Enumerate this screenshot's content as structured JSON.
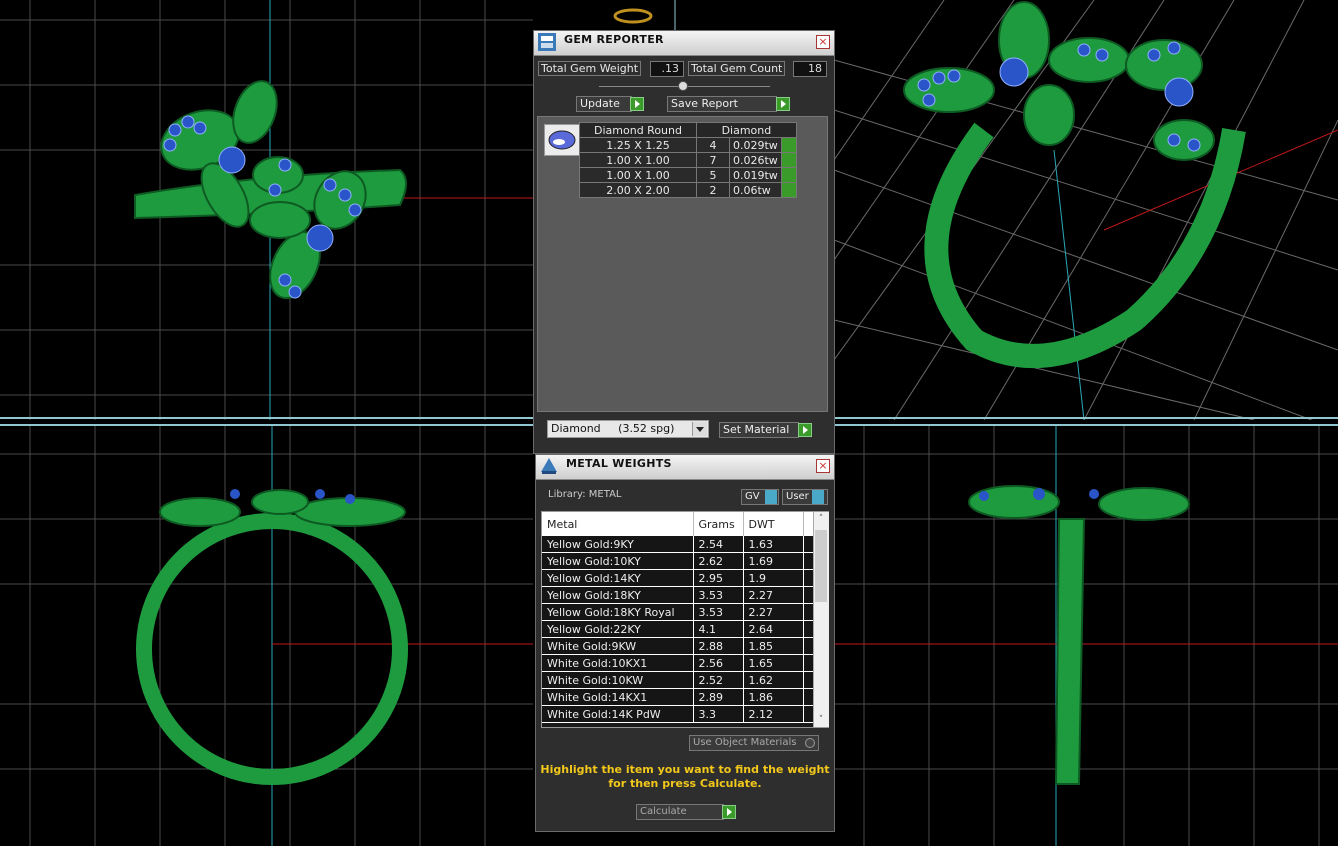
{
  "gem_reporter": {
    "title": "GEM REPORTER",
    "total_gem_weight_label": "Total Gem Weight",
    "total_gem_weight_value": ".13",
    "total_gem_count_label": "Total Gem Count",
    "total_gem_count_value": "18",
    "update_label": "Update",
    "save_report_label": "Save Report",
    "table_headers": [
      "Diamond Round",
      "Diamond"
    ],
    "rows": [
      {
        "size": "1.25 X 1.25",
        "count": "4",
        "weight": "0.029tw"
      },
      {
        "size": "1.00 X 1.00",
        "count": "7",
        "weight": "0.026tw"
      },
      {
        "size": "1.00 X 1.00",
        "count": "5",
        "weight": "0.019tw"
      },
      {
        "size": "2.00 X 2.00",
        "count": "2",
        "weight": "0.06tw"
      }
    ],
    "material_select": "Diamond     (3.52 spg)",
    "set_material_label": "Set Material"
  },
  "metal_weights": {
    "title": "METAL WEIGHTS",
    "library_label": "Library: METAL",
    "gv_label": "GV",
    "user_label": "User",
    "columns": [
      "Metal",
      "Grams",
      "DWT"
    ],
    "rows": [
      {
        "metal": "Yellow Gold:9KY",
        "grams": "2.54",
        "dwt": "1.63"
      },
      {
        "metal": "Yellow Gold:10KY",
        "grams": "2.62",
        "dwt": "1.69"
      },
      {
        "metal": "Yellow Gold:14KY",
        "grams": "2.95",
        "dwt": "1.9"
      },
      {
        "metal": "Yellow Gold:18KY",
        "grams": "3.53",
        "dwt": "2.27"
      },
      {
        "metal": "Yellow Gold:18KY Royal",
        "grams": "3.53",
        "dwt": "2.27"
      },
      {
        "metal": "Yellow Gold:22KY",
        "grams": "4.1",
        "dwt": "2.64"
      },
      {
        "metal": "White Gold:9KW",
        "grams": "2.88",
        "dwt": "1.85"
      },
      {
        "metal": "White Gold:10KX1",
        "grams": "2.56",
        "dwt": "1.65"
      },
      {
        "metal": "White Gold:10KW",
        "grams": "2.52",
        "dwt": "1.62"
      },
      {
        "metal": "White Gold:14KX1",
        "grams": "2.89",
        "dwt": "1.86"
      },
      {
        "metal": "White Gold:14K PdW",
        "grams": "3.3",
        "dwt": "2.12"
      }
    ],
    "use_object_materials_label": "Use Object Materials",
    "hint_line1": "Highlight the item you want to find the weight",
    "hint_line2": "for then press Calculate.",
    "calculate_label": "Calculate"
  },
  "colors": {
    "ring_green": "#1f9b3f",
    "gem_blue": "#2a55c8",
    "grid": "#5a5a5a",
    "axis_red": "#c01818",
    "axis_cyan": "#2aa8b8",
    "hint_yellow": "#f2c81a"
  }
}
